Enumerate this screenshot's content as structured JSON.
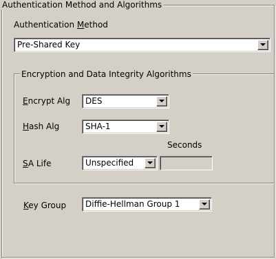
{
  "auth_group": {
    "title": "Authentication Method and Algorithms",
    "method_label_pre": "Authentication ",
    "method_label_mnemonic": "M",
    "method_label_post": "ethod",
    "method_value": "Pre-Shared Key"
  },
  "enc_group": {
    "title": "Encryption and Data Integrity Algorithms",
    "encrypt": {
      "mnemonic": "E",
      "label_rest": "ncrypt Alg",
      "value": "DES"
    },
    "hash": {
      "mnemonic": "H",
      "label_rest": "ash Alg",
      "value": "SHA-1"
    },
    "seconds_label": "Seconds",
    "sa_life": {
      "mnemonic": "S",
      "label_rest": "A Life",
      "value": "Unspecified",
      "seconds_value": ""
    }
  },
  "key_group": {
    "mnemonic": "K",
    "label_rest": "ey Group",
    "value": "Diffie-Hellman Group 1"
  },
  "icons": [
    "chevron-down-icon"
  ]
}
